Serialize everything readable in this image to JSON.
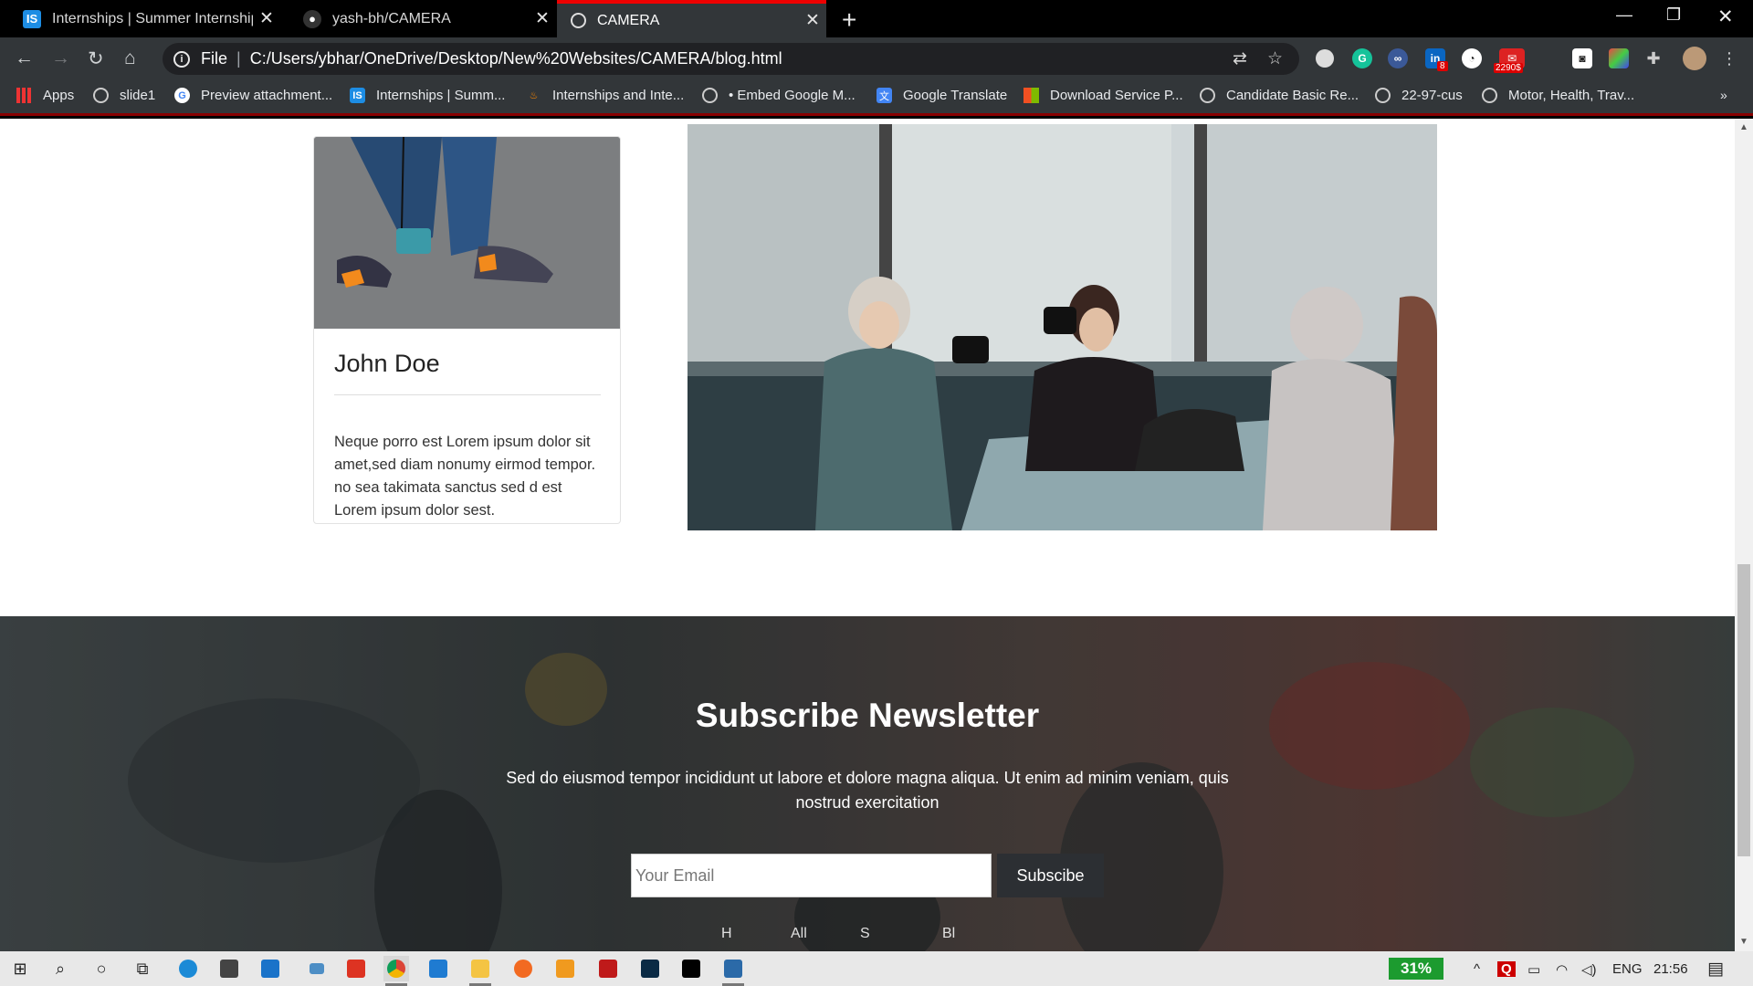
{
  "browser": {
    "tabs": [
      {
        "title": "Internships | Summer Internship",
        "favicon": "IS",
        "active": false
      },
      {
        "title": "yash-bh/CAMERA",
        "favicon": "github-icon",
        "active": false
      },
      {
        "title": "CAMERA",
        "favicon": "globe-icon",
        "active": true
      }
    ],
    "address": {
      "label": "File",
      "url": "C:/Users/ybhar/OneDrive/Desktop/New%20Websites/CAMERA/blog.html"
    },
    "ext_badges": {
      "linkedin": "8",
      "mail": "2290$"
    },
    "bookmarks": [
      {
        "label": "Apps",
        "icon": "apps-grid-icon"
      },
      {
        "label": "slide1",
        "icon": "globe-icon"
      },
      {
        "label": "Preview attachment...",
        "icon": "google-icon"
      },
      {
        "label": "Internships | Summ...",
        "icon": "internshala-icon"
      },
      {
        "label": "Internships and Inte...",
        "icon": "fire-icon"
      },
      {
        "label": "• Embed Google M...",
        "icon": "globe-icon"
      },
      {
        "label": "Google Translate",
        "icon": "translate-icon"
      },
      {
        "label": "Download Service P...",
        "icon": "microsoft-icon"
      },
      {
        "label": "Candidate Basic Re...",
        "icon": "globe-icon"
      },
      {
        "label": "22-97-cus",
        "icon": "globe-icon"
      },
      {
        "label": "Motor, Health, Trav...",
        "icon": "globe-icon"
      }
    ]
  },
  "card": {
    "name": "John Doe",
    "text": "Neque porro est Lorem ipsum dolor sit amet,sed diam nonumy eirmod tempor. no sea takimata sanctus sed d est Lorem ipsum dolor sest."
  },
  "newsletter": {
    "title": "Subscribe Newsletter",
    "subtitle": "Sed do eiusmod tempor incididunt ut labore et dolore magna aliqua. Ut enim ad minim veniam, quis nostrud exercitation",
    "email_placeholder": "Your Email",
    "button": "Subscibe",
    "footer_links": [
      "H",
      "All",
      "S",
      "Bl"
    ]
  },
  "taskbar": {
    "battery": "31%",
    "lang": "ENG",
    "time": "21:56"
  },
  "colors": {
    "accent": "#e00000",
    "chrome_dark": "#323639",
    "button_dark": "#2c2f33"
  }
}
